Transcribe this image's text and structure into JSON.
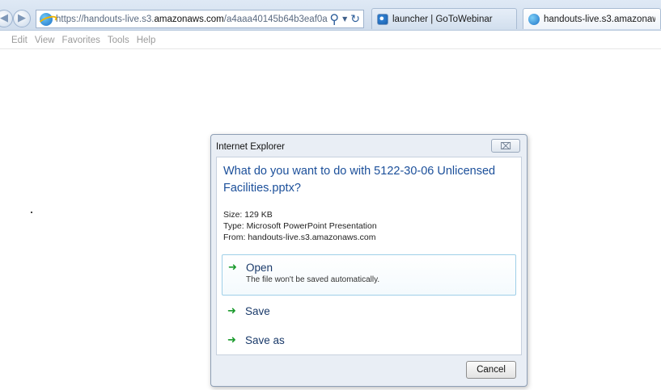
{
  "browser": {
    "address_url_prefix": "https://handouts-live.s3.",
    "address_url_domain": "amazonaws.com",
    "address_url_suffix": "/a4aaa40145b64b3eaf0a",
    "tabs": [
      {
        "label": "launcher | GoToWebinar"
      },
      {
        "label": "handouts-live.s3.amazonaw..."
      }
    ],
    "menu": [
      "Edit",
      "View",
      "Favorites",
      "Tools",
      "Help"
    ]
  },
  "dialog": {
    "title": "Internet Explorer",
    "close_glyph": "⌧",
    "question": "What do you want to do with 5122-30-06 Unlicensed Facilities.pptx?",
    "size": "Size: 129 KB",
    "type": "Type: Microsoft PowerPoint Presentation",
    "from": "From: handouts-live.s3.amazonaws.com",
    "options": {
      "open": {
        "label": "Open",
        "description": "The file won't be saved automatically."
      },
      "save": {
        "label": "Save"
      },
      "save_as": {
        "label": "Save as"
      }
    },
    "cancel_label": "Cancel"
  },
  "colors": {
    "accent_text": "#1b4f9a",
    "arrow_green": "#1a9a2c"
  }
}
